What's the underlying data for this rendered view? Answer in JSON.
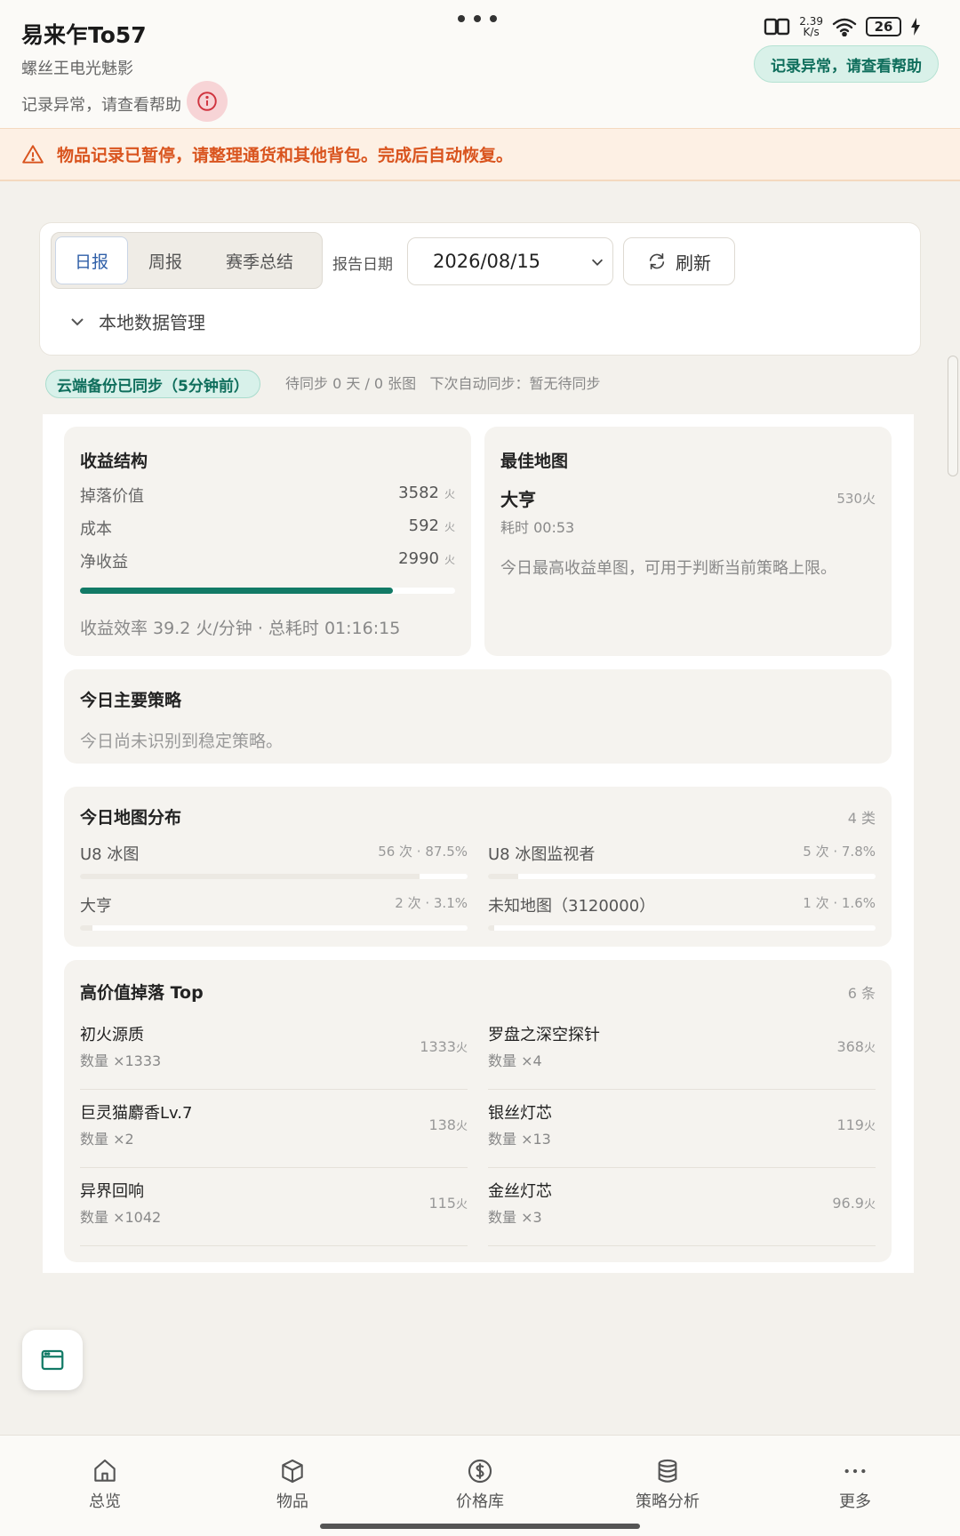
{
  "header": {
    "title": "易来乍To57",
    "subtitle": "螺丝王电光魅影",
    "status_note": "记录异常，请查看帮助",
    "alert_pill": "记录异常，请查看帮助",
    "net_speed_value": "2.39",
    "net_speed_unit": "K/s",
    "battery": "26"
  },
  "banner": {
    "text": "物品记录已暂停，请整理通货和其他背包。完成后自动恢复。"
  },
  "controls": {
    "tabs": [
      "日报",
      "周报",
      "赛季总结"
    ],
    "date_label": "报告日期",
    "date_value": "2026/08/15",
    "refresh_label": "刷新",
    "local_mgmt_label": "本地数据管理"
  },
  "sync": {
    "badge": "云端备份已同步（5分钟前）",
    "info": "待同步 0 天 / 0 张图   下次自动同步：暂无待同步"
  },
  "income": {
    "title": "收益结构",
    "rows": [
      {
        "label": "掉落价值",
        "value": "3582",
        "unit": "火"
      },
      {
        "label": "成本",
        "value": "592",
        "unit": "火"
      },
      {
        "label": "净收益",
        "value": "2990",
        "unit": "火"
      }
    ],
    "progress_fraction": 0.835,
    "efficiency": "收益效率 39.2 火/分钟 · 总耗时 01:16:15"
  },
  "best_map": {
    "title": "最佳地图",
    "name": "大亨",
    "value": "530火",
    "time": "耗时 00:53",
    "desc": "今日最高收益单图，可用于判断当前策略上限。"
  },
  "strategy": {
    "title": "今日主要策略",
    "text": "今日尚未识别到稳定策略。"
  },
  "distribution": {
    "title": "今日地图分布",
    "count": "4 类",
    "items": [
      {
        "name": "U8 冰图",
        "stat": "56 次 · 87.5%"
      },
      {
        "name": "U8 冰图监视者",
        "stat": "5 次 · 7.8%"
      },
      {
        "name": "大亨",
        "stat": "2 次 · 3.1%"
      },
      {
        "name": "未知地图（3120000）",
        "stat": "1 次 · 1.6%"
      }
    ]
  },
  "drops": {
    "title": "高价值掉落 Top",
    "count": "6 条",
    "items": [
      {
        "name": "初火源质",
        "qty": "数量 ×1333",
        "value": "1333",
        "unit": "火"
      },
      {
        "name": "罗盘之深空探针",
        "qty": "数量 ×4",
        "value": "368",
        "unit": "火"
      },
      {
        "name": "巨灵猫麝香Lv.7",
        "qty": "数量 ×2",
        "value": "138",
        "unit": "火"
      },
      {
        "name": "银丝灯芯",
        "qty": "数量 ×13",
        "value": "119",
        "unit": "火"
      },
      {
        "name": "异界回响",
        "qty": "数量 ×1042",
        "value": "115",
        "unit": "火"
      },
      {
        "name": "金丝灯芯",
        "qty": "数量 ×3",
        "value": "96.9",
        "unit": "火"
      }
    ]
  },
  "nav": {
    "items": [
      {
        "label": "总览",
        "icon": "home-icon"
      },
      {
        "label": "物品",
        "icon": "box-icon"
      },
      {
        "label": "价格库",
        "icon": "dollar-icon"
      },
      {
        "label": "策略分析",
        "icon": "database-icon"
      },
      {
        "label": "更多",
        "icon": "more-icon"
      }
    ]
  },
  "colors": {
    "accent": "#127a66",
    "warning": "#d9541e",
    "error": "#d0343f",
    "tab_active": "#2f5fa8"
  }
}
